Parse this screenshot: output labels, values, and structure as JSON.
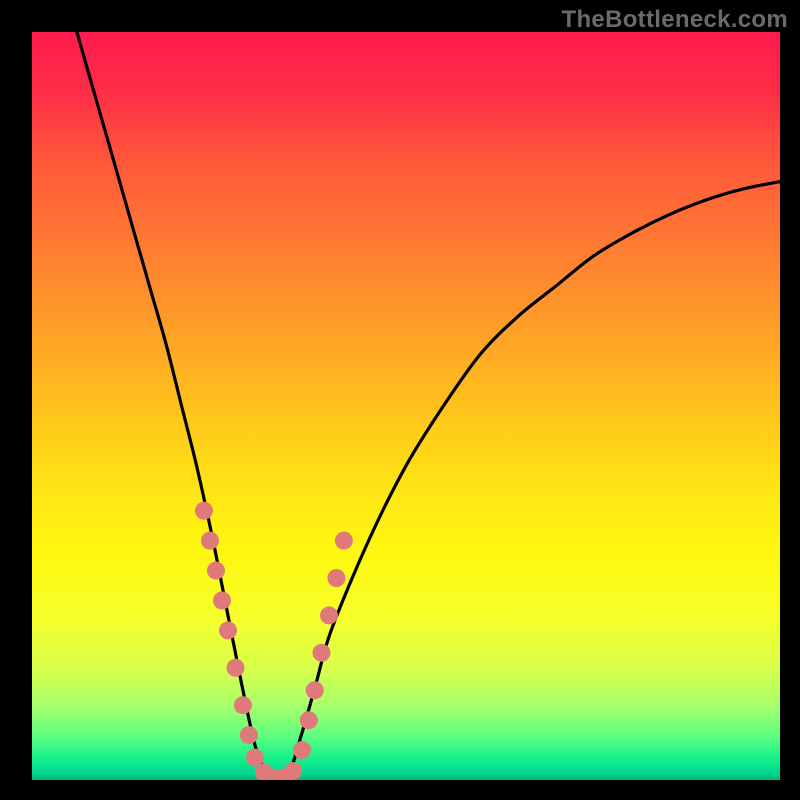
{
  "watermark": "TheBottleneck.com",
  "chart_data": {
    "type": "line",
    "title": "",
    "xlabel": "",
    "ylabel": "",
    "xlim": [
      0,
      100
    ],
    "ylim": [
      0,
      100
    ],
    "note": "Axes have no tick labels or numeric scale in the source image; x and y are in relative 0–100 units estimated from pixel positions.",
    "series": [
      {
        "name": "bottleneck-curve",
        "x": [
          6,
          8,
          10,
          12,
          14,
          16,
          18,
          20,
          22,
          24,
          26,
          28,
          30,
          32,
          34,
          36,
          38,
          40,
          45,
          50,
          55,
          60,
          65,
          70,
          75,
          80,
          85,
          90,
          95,
          100
        ],
        "y": [
          100,
          93,
          86,
          79,
          72,
          65,
          58,
          50,
          42,
          33,
          23,
          13,
          4,
          0,
          0,
          6,
          13,
          20,
          32,
          42,
          50,
          57,
          62,
          66,
          70,
          73,
          75.5,
          77.5,
          79,
          80
        ]
      }
    ],
    "markers": {
      "name": "highlighted-points",
      "note": "Pink dots clustered near the valley of the curve; values in relative 0–100 units.",
      "points": [
        {
          "x": 23.0,
          "y": 36
        },
        {
          "x": 23.8,
          "y": 32
        },
        {
          "x": 24.6,
          "y": 28
        },
        {
          "x": 25.4,
          "y": 24
        },
        {
          "x": 26.2,
          "y": 20
        },
        {
          "x": 27.2,
          "y": 15
        },
        {
          "x": 28.2,
          "y": 10
        },
        {
          "x": 29.0,
          "y": 6
        },
        {
          "x": 29.8,
          "y": 3
        },
        {
          "x": 31.0,
          "y": 1
        },
        {
          "x": 32.3,
          "y": 0.3
        },
        {
          "x": 33.6,
          "y": 0.3
        },
        {
          "x": 34.9,
          "y": 1.2
        },
        {
          "x": 36.1,
          "y": 4
        },
        {
          "x": 37.0,
          "y": 8
        },
        {
          "x": 37.8,
          "y": 12
        },
        {
          "x": 38.7,
          "y": 17
        },
        {
          "x": 39.7,
          "y": 22
        },
        {
          "x": 40.7,
          "y": 27
        },
        {
          "x": 41.7,
          "y": 32
        }
      ]
    },
    "colors": {
      "curve": "#000000",
      "marker": "#e07a7a",
      "gradient_top": "#ff1a4d",
      "gradient_mid": "#ffe814",
      "gradient_bottom": "#00d88f"
    }
  }
}
